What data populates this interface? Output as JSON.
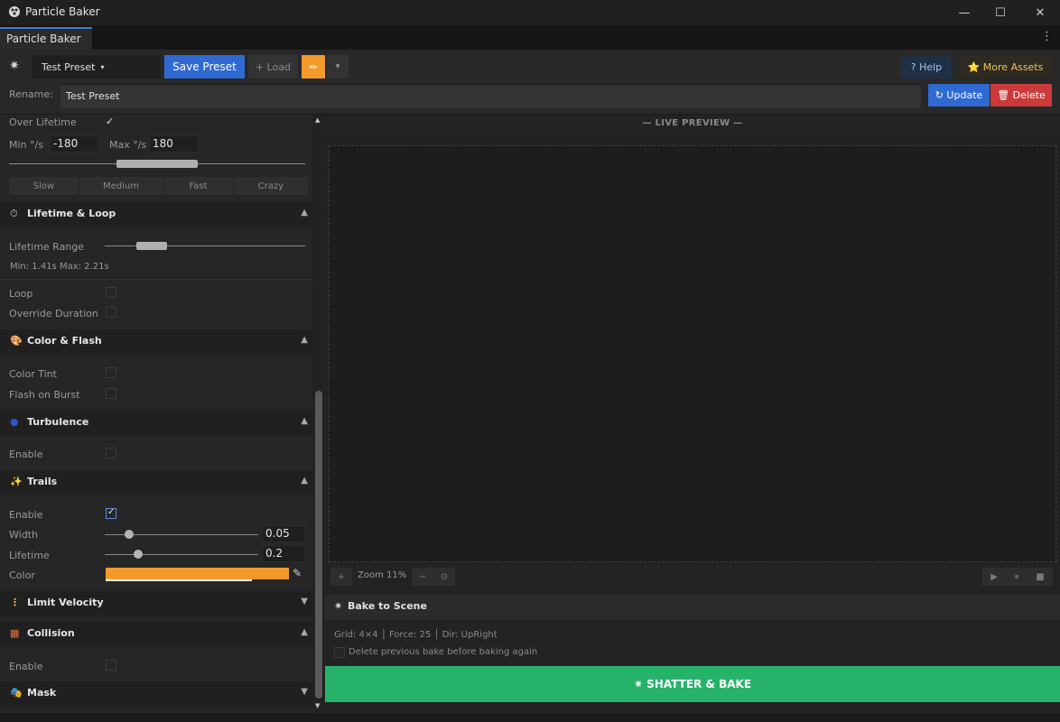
{
  "window": {
    "title": "Particle Baker",
    "minimize": "—",
    "maximize": "☐",
    "close": "✕"
  },
  "tabs": {
    "main": "Particle Baker",
    "menu": "⋮"
  },
  "toolbar": {
    "logo": "✷",
    "preset_selected": "Test Preset",
    "preset_caret": "▾",
    "save_preset": "Save Preset",
    "load": "+ Load",
    "edit": "✏",
    "edit_dropdown": "▾",
    "help": "? Help",
    "more_assets": "⭐ More Assets",
    "rename_label": "Rename:",
    "rename_value": "Test Preset",
    "update": "↻ Update",
    "delete": "🗑 Delete"
  },
  "rotation": {
    "over_lifetime_label": "Over Lifetime",
    "over_lifetime_checked": true,
    "check": "✓",
    "min_label": "Min °/s",
    "min_value": "-180",
    "max_label": "Max °/s",
    "max_value": "180",
    "range_min": -180,
    "range_max": 180,
    "speed_presets": [
      "Slow",
      "Medium",
      "Fast",
      "Crazy"
    ]
  },
  "sections": {
    "lifetime_loop": {
      "title": "Lifetime & Loop",
      "icon": "⏱",
      "arrow": "▲"
    },
    "color_flash": {
      "title": "Color & Flash",
      "icon": "🎨",
      "arrow": "▲"
    },
    "turbulence": {
      "title": "Turbulence",
      "icon": "●",
      "arrow": "▲"
    },
    "trails": {
      "title": "Trails",
      "icon": "✨",
      "arrow": "▲"
    },
    "limit_velocity": {
      "title": "Limit Velocity",
      "icon": "⋮",
      "arrow": "▼"
    },
    "collision": {
      "title": "Collision",
      "icon": "▦",
      "arrow": "▲"
    },
    "mask": {
      "title": "Mask",
      "icon": "🎭",
      "arrow": "▼"
    }
  },
  "lifetime": {
    "range_label": "Lifetime Range",
    "min_max_text": "Min: 1.41s   Max: 2.21s",
    "loop_label": "Loop",
    "loop_checked": false,
    "override_label": "Override Duration",
    "override_checked": false
  },
  "color_flash": {
    "tint_label": "Color Tint",
    "tint_checked": false,
    "flash_label": "Flash on Burst",
    "flash_checked": false
  },
  "turbulence": {
    "enable_label": "Enable",
    "enable_checked": false
  },
  "trails": {
    "enable_label": "Enable",
    "enable_checked": true,
    "width_label": "Width",
    "width_value": "0.05",
    "lifetime_label": "Lifetime",
    "lifetime_value": "0.2",
    "color_label": "Color",
    "color": "#f39a2b",
    "picker_icon": "✎"
  },
  "collision": {
    "enable_label": "Enable",
    "enable_checked": false
  },
  "scroll": {
    "up": "▲",
    "down": "▼"
  },
  "preview": {
    "title": "— LIVE PREVIEW —",
    "zoom_in": "+",
    "zoom_text": "Zoom 11%",
    "zoom_out": "−",
    "reset": "⊙",
    "play": "▶",
    "pause": "⏸",
    "stop": "■"
  },
  "bake": {
    "icon": "✷",
    "title": "Bake to Scene",
    "info": "Grid: 4×4  │  Force: 25  │  Dir: UpRight",
    "delete_previous_label": "Delete previous bake before baking again",
    "delete_previous_checked": false,
    "shatter_button": "✷  SHATTER & BAKE"
  },
  "colors": {
    "accent_blue": "#2e6ad1",
    "accent_orange": "#f39a2b",
    "danger_red": "#cc3a3a",
    "success_green": "#27b26a",
    "gold": "#f0c25a"
  }
}
